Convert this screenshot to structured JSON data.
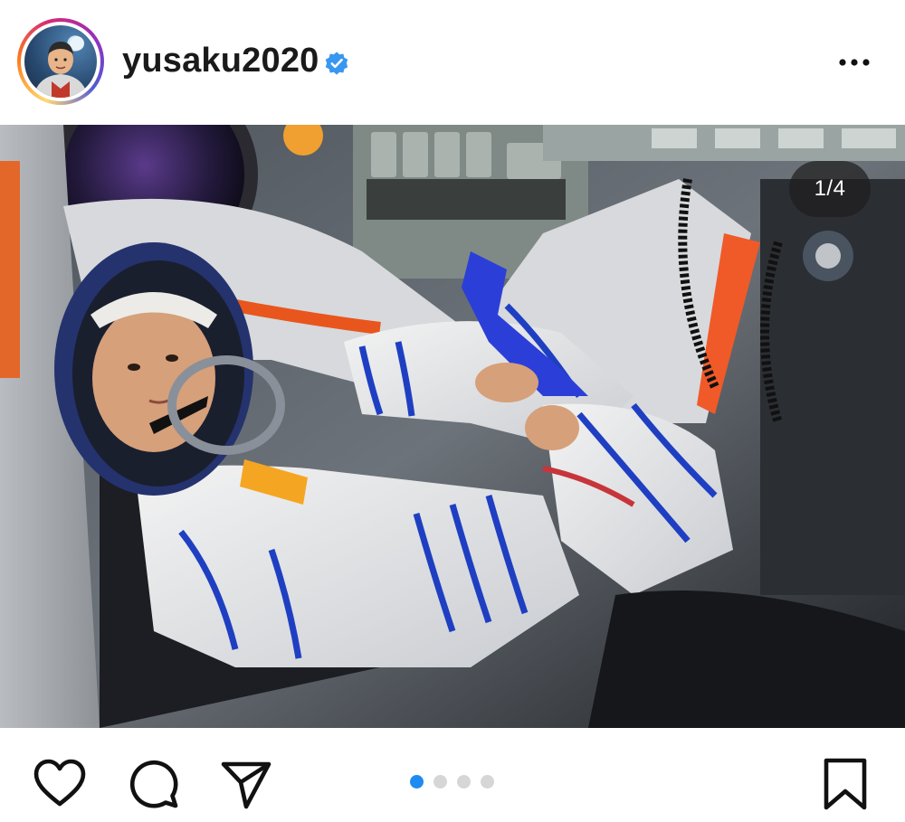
{
  "header": {
    "username": "yusaku2020",
    "verified": true,
    "avatar_alt": "profile-avatar",
    "more_icon": "more-horizontal-icon"
  },
  "photo": {
    "counter": "1/4"
  },
  "actions": {
    "like_icon": "heart-icon",
    "comment_icon": "comment-icon",
    "share_icon": "send-icon",
    "save_icon": "bookmark-icon"
  },
  "carousel": {
    "total": 4,
    "active_index": 0
  },
  "colors": {
    "verified_blue": "#3897f0",
    "active_dot": "#1f8bf2",
    "inactive_dot": "#d6d6d6"
  }
}
